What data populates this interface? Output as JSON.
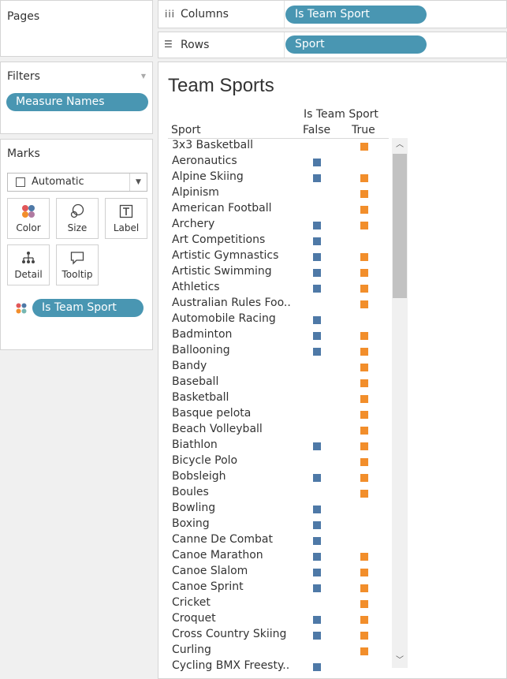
{
  "pages": {
    "title": "Pages"
  },
  "filters": {
    "title": "Filters",
    "pill": "Measure Names"
  },
  "marks": {
    "title": "Marks",
    "mark_type": "Automatic",
    "buttons": [
      "Color",
      "Size",
      "Label",
      "Detail",
      "Tooltip"
    ],
    "color_pill": "Is Team Sport"
  },
  "columns": {
    "label": "Columns",
    "pill": "Is Team Sport"
  },
  "rows": {
    "label": "Rows",
    "pill": "Sport"
  },
  "view": {
    "title": "Team Sports",
    "row_header": "Sport",
    "col_header": "Is Team Sport",
    "col_false": "False",
    "col_true": "True"
  },
  "colors": {
    "false": "#4e79a7",
    "true": "#f28e2b",
    "pill": "#4996b2"
  },
  "chart_data": {
    "type": "table",
    "title": "Team Sports",
    "columns": [
      "False",
      "True"
    ],
    "rows": [
      {
        "sport": "3x3 Basketball",
        "f": false,
        "t": true
      },
      {
        "sport": "Aeronautics",
        "f": true,
        "t": false
      },
      {
        "sport": "Alpine Skiing",
        "f": true,
        "t": true
      },
      {
        "sport": "Alpinism",
        "f": false,
        "t": true
      },
      {
        "sport": "American Football",
        "f": false,
        "t": true
      },
      {
        "sport": "Archery",
        "f": true,
        "t": true
      },
      {
        "sport": "Art Competitions",
        "f": true,
        "t": false
      },
      {
        "sport": "Artistic Gymnastics",
        "f": true,
        "t": true
      },
      {
        "sport": "Artistic Swimming",
        "f": true,
        "t": true
      },
      {
        "sport": "Athletics",
        "f": true,
        "t": true
      },
      {
        "sport": "Australian Rules Foo..",
        "f": false,
        "t": true
      },
      {
        "sport": "Automobile Racing",
        "f": true,
        "t": false
      },
      {
        "sport": "Badminton",
        "f": true,
        "t": true
      },
      {
        "sport": "Ballooning",
        "f": true,
        "t": true
      },
      {
        "sport": "Bandy",
        "f": false,
        "t": true
      },
      {
        "sport": "Baseball",
        "f": false,
        "t": true
      },
      {
        "sport": "Basketball",
        "f": false,
        "t": true
      },
      {
        "sport": "Basque pelota",
        "f": false,
        "t": true
      },
      {
        "sport": "Beach Volleyball",
        "f": false,
        "t": true
      },
      {
        "sport": "Biathlon",
        "f": true,
        "t": true
      },
      {
        "sport": "Bicycle Polo",
        "f": false,
        "t": true
      },
      {
        "sport": "Bobsleigh",
        "f": true,
        "t": true
      },
      {
        "sport": "Boules",
        "f": false,
        "t": true
      },
      {
        "sport": "Bowling",
        "f": true,
        "t": false
      },
      {
        "sport": "Boxing",
        "f": true,
        "t": false
      },
      {
        "sport": "Canne De Combat",
        "f": true,
        "t": false
      },
      {
        "sport": "Canoe Marathon",
        "f": true,
        "t": true
      },
      {
        "sport": "Canoe Slalom",
        "f": true,
        "t": true
      },
      {
        "sport": "Canoe Sprint",
        "f": true,
        "t": true
      },
      {
        "sport": "Cricket",
        "f": false,
        "t": true
      },
      {
        "sport": "Croquet",
        "f": true,
        "t": true
      },
      {
        "sport": "Cross Country Skiing",
        "f": true,
        "t": true
      },
      {
        "sport": "Curling",
        "f": false,
        "t": true
      },
      {
        "sport": "Cycling BMX Freesty..",
        "f": true,
        "t": false
      }
    ]
  }
}
